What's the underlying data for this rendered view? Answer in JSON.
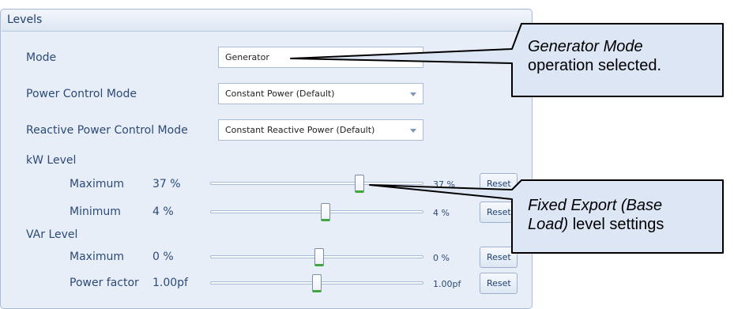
{
  "panel": {
    "title": "Levels"
  },
  "mode": {
    "label": "Mode",
    "value": "Generator"
  },
  "power_control_mode": {
    "label": "Power Control Mode",
    "value": "Constant Power (Default)"
  },
  "reactive_power_control_mode": {
    "label": "Reactive Power Control Mode",
    "value": "Constant Reactive Power (Default)"
  },
  "kw_level": {
    "label": "kW Level",
    "maximum": {
      "label": "Maximum",
      "value": "37 %",
      "slider_value": "37 %",
      "reset_label": "Reset",
      "slider_fraction": 0.7
    },
    "minimum": {
      "label": "Minimum",
      "value": "4 %",
      "slider_value": "4 %",
      "reset_label": "Reset",
      "slider_fraction": 0.54
    }
  },
  "var_level": {
    "label": "VAr Level",
    "maximum": {
      "label": "Maximum",
      "value": "0 %",
      "slider_value": "0 %",
      "reset_label": "Reset",
      "slider_fraction": 0.51
    },
    "power_factor": {
      "label": "Power factor",
      "value": "1.00pf",
      "slider_value": "1.00pf",
      "reset_label": "Reset",
      "slider_fraction": 0.5
    }
  },
  "callouts": {
    "mode": {
      "italic": "Generator Mode",
      "rest": "operation selected."
    },
    "fixed_export": {
      "italic_1": "Fixed Export (Base",
      "italic_2": "Load)",
      "rest": "level settings"
    }
  },
  "colors": {
    "panel_bg": "#e8eef7",
    "border": "#a9bcd6",
    "text": "#2b4a78",
    "thumb_accent": "#3ea83e",
    "callout_fill": "#dce6f4"
  }
}
